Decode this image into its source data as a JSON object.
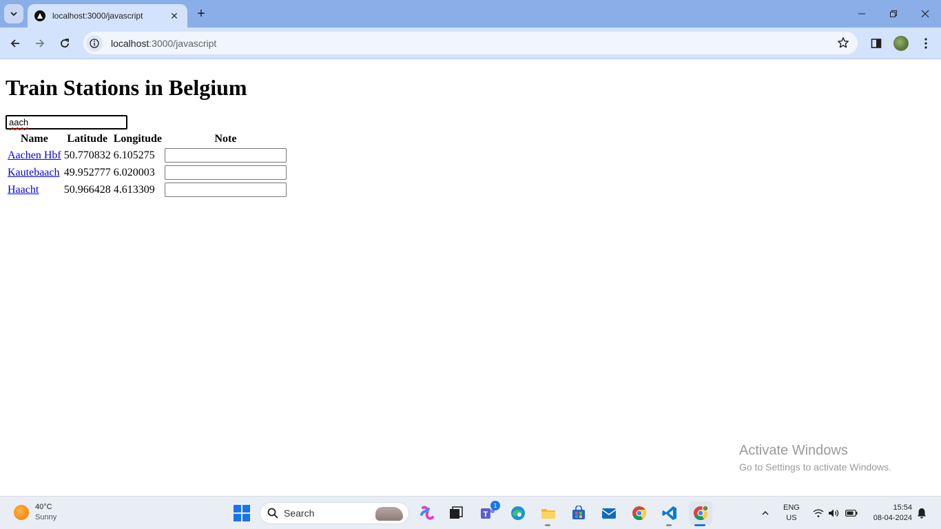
{
  "browser": {
    "tab_title": "localhost:3000/javascript",
    "url_host": "localhost",
    "url_path": ":3000/javascript"
  },
  "page": {
    "heading": "Train Stations in Belgium",
    "filter_value": "aach",
    "columns": [
      "Name",
      "Latitude",
      "Longitude",
      "Note"
    ],
    "rows": [
      {
        "name": "Aachen Hbf",
        "lat": "50.770832",
        "lon": "6.105275",
        "note": ""
      },
      {
        "name": "Kautebaach",
        "lat": "49.952777",
        "lon": "6.020003",
        "note": ""
      },
      {
        "name": "Haacht",
        "lat": "50.966428",
        "lon": "4.613309",
        "note": ""
      }
    ]
  },
  "watermark": {
    "line1": "Activate Windows",
    "line2": "Go to Settings to activate Windows."
  },
  "taskbar": {
    "temperature": "40°C",
    "condition": "Sunny",
    "search_label": "Search",
    "teams_badge": "1",
    "lang_line1": "ENG",
    "lang_line2": "US",
    "time": "15:54",
    "date": "08-04-2024"
  },
  "colors": {
    "tabstrip": "#8aaee8",
    "toolbar": "#d3e3fd",
    "link": "#0000ee",
    "taskbar": "#e9eef5"
  }
}
